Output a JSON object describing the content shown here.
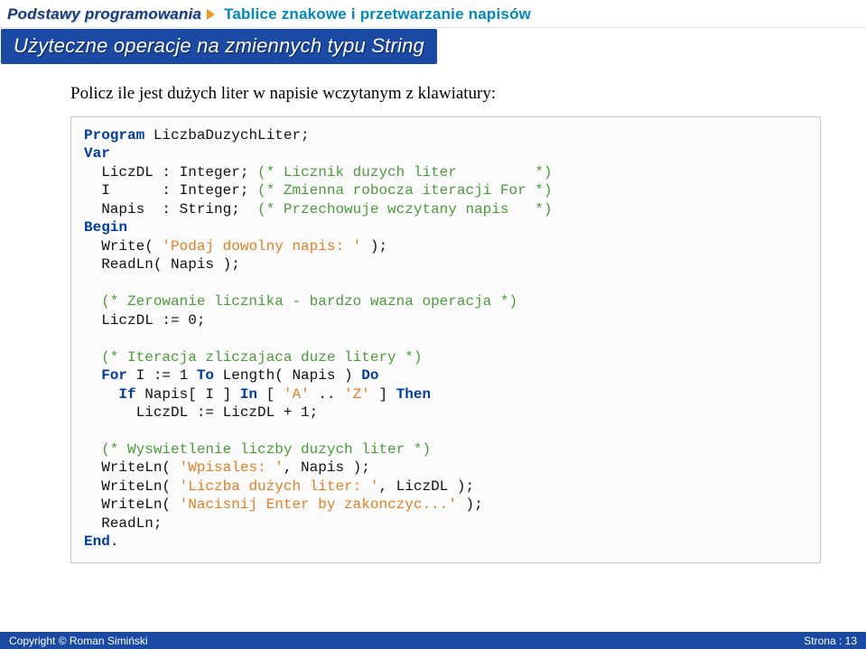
{
  "header": {
    "brand": "Podstawy programowania",
    "subject": "Tablice znakowe i przetwarzanie napisów"
  },
  "title": "Użyteczne operacje na zmiennych typu String",
  "prompt": "Policz ile jest dużych liter w napisie wczytanym z klawiatury:",
  "code": {
    "l01a": "Program",
    "l01b": " LiczbaDuzychLiter;",
    "l02": "Var",
    "l03a": "  LiczDL : Integer; ",
    "l03b": "(* Licznik duzych liter         *)",
    "l04a": "  I      : Integer; ",
    "l04b": "(* Zmienna robocza iteracji For *)",
    "l05a": "  Napis  : String;  ",
    "l05b": "(* Przechowuje wczytany napis   *)",
    "l06": "Begin",
    "l07a": "  Write( ",
    "l07b": "'Podaj dowolny napis: '",
    "l07c": " );",
    "l08": "  ReadLn( Napis );",
    "l10a": "  ",
    "l10b": "(* Zerowanie licznika - bardzo wazna operacja *)",
    "l11": "  LiczDL := 0;",
    "l13a": "  ",
    "l13b": "(* Iteracja zliczajaca duze litery *)",
    "l14a": "  ",
    "l14b": "For",
    "l14c": " I := 1 ",
    "l14d": "To",
    "l14e": " Length( Napis ) ",
    "l14f": "Do",
    "l15a": "    ",
    "l15b": "If",
    "l15c": " Napis[ I ] ",
    "l15d": "In",
    "l15e": " [ ",
    "l15f": "'A'",
    "l15g": " .. ",
    "l15h": "'Z'",
    "l15i": " ] ",
    "l15j": "Then",
    "l16": "      LiczDL := LiczDL + 1;",
    "l18a": "  ",
    "l18b": "(* Wyswietlenie liczby duzych liter *)",
    "l19a": "  WriteLn( ",
    "l19b": "'Wpisales: '",
    "l19c": ", Napis );",
    "l20a": "  WriteLn( ",
    "l20b": "'Liczba dużych liter: '",
    "l20c": ", LiczDL );",
    "l21a": "  WriteLn( ",
    "l21b": "'Nacisnij Enter by zakonczyc...'",
    "l21c": " );",
    "l22": "  ReadLn;",
    "l23": "End",
    "l23b": "."
  },
  "footer": {
    "copyright_label": "Copyright © ",
    "author": "Roman Simiński",
    "page_label": "Strona : ",
    "page_num": "13"
  }
}
